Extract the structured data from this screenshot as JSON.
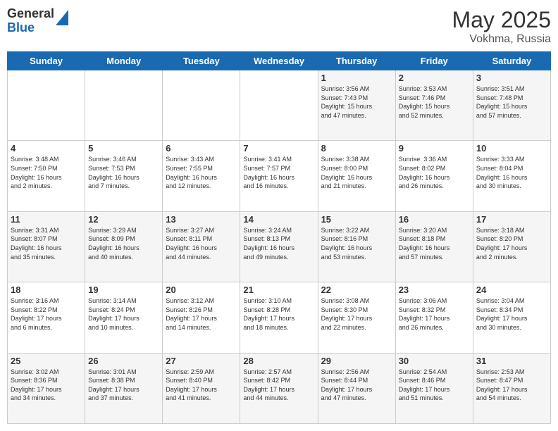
{
  "logo": {
    "general": "General",
    "blue": "Blue"
  },
  "header": {
    "month": "May 2025",
    "location": "Vokhma, Russia"
  },
  "days_of_week": [
    "Sunday",
    "Monday",
    "Tuesday",
    "Wednesday",
    "Thursday",
    "Friday",
    "Saturday"
  ],
  "weeks": [
    [
      {
        "day": "",
        "info": ""
      },
      {
        "day": "",
        "info": ""
      },
      {
        "day": "",
        "info": ""
      },
      {
        "day": "",
        "info": ""
      },
      {
        "day": "1",
        "info": "Sunrise: 3:56 AM\nSunset: 7:43 PM\nDaylight: 15 hours\nand 47 minutes."
      },
      {
        "day": "2",
        "info": "Sunrise: 3:53 AM\nSunset: 7:46 PM\nDaylight: 15 hours\nand 52 minutes."
      },
      {
        "day": "3",
        "info": "Sunrise: 3:51 AM\nSunset: 7:48 PM\nDaylight: 15 hours\nand 57 minutes."
      }
    ],
    [
      {
        "day": "4",
        "info": "Sunrise: 3:48 AM\nSunset: 7:50 PM\nDaylight: 16 hours\nand 2 minutes."
      },
      {
        "day": "5",
        "info": "Sunrise: 3:46 AM\nSunset: 7:53 PM\nDaylight: 16 hours\nand 7 minutes."
      },
      {
        "day": "6",
        "info": "Sunrise: 3:43 AM\nSunset: 7:55 PM\nDaylight: 16 hours\nand 12 minutes."
      },
      {
        "day": "7",
        "info": "Sunrise: 3:41 AM\nSunset: 7:57 PM\nDaylight: 16 hours\nand 16 minutes."
      },
      {
        "day": "8",
        "info": "Sunrise: 3:38 AM\nSunset: 8:00 PM\nDaylight: 16 hours\nand 21 minutes."
      },
      {
        "day": "9",
        "info": "Sunrise: 3:36 AM\nSunset: 8:02 PM\nDaylight: 16 hours\nand 26 minutes."
      },
      {
        "day": "10",
        "info": "Sunrise: 3:33 AM\nSunset: 8:04 PM\nDaylight: 16 hours\nand 30 minutes."
      }
    ],
    [
      {
        "day": "11",
        "info": "Sunrise: 3:31 AM\nSunset: 8:07 PM\nDaylight: 16 hours\nand 35 minutes."
      },
      {
        "day": "12",
        "info": "Sunrise: 3:29 AM\nSunset: 8:09 PM\nDaylight: 16 hours\nand 40 minutes."
      },
      {
        "day": "13",
        "info": "Sunrise: 3:27 AM\nSunset: 8:11 PM\nDaylight: 16 hours\nand 44 minutes."
      },
      {
        "day": "14",
        "info": "Sunrise: 3:24 AM\nSunset: 8:13 PM\nDaylight: 16 hours\nand 49 minutes."
      },
      {
        "day": "15",
        "info": "Sunrise: 3:22 AM\nSunset: 8:16 PM\nDaylight: 16 hours\nand 53 minutes."
      },
      {
        "day": "16",
        "info": "Sunrise: 3:20 AM\nSunset: 8:18 PM\nDaylight: 16 hours\nand 57 minutes."
      },
      {
        "day": "17",
        "info": "Sunrise: 3:18 AM\nSunset: 8:20 PM\nDaylight: 17 hours\nand 2 minutes."
      }
    ],
    [
      {
        "day": "18",
        "info": "Sunrise: 3:16 AM\nSunset: 8:22 PM\nDaylight: 17 hours\nand 6 minutes."
      },
      {
        "day": "19",
        "info": "Sunrise: 3:14 AM\nSunset: 8:24 PM\nDaylight: 17 hours\nand 10 minutes."
      },
      {
        "day": "20",
        "info": "Sunrise: 3:12 AM\nSunset: 8:26 PM\nDaylight: 17 hours\nand 14 minutes."
      },
      {
        "day": "21",
        "info": "Sunrise: 3:10 AM\nSunset: 8:28 PM\nDaylight: 17 hours\nand 18 minutes."
      },
      {
        "day": "22",
        "info": "Sunrise: 3:08 AM\nSunset: 8:30 PM\nDaylight: 17 hours\nand 22 minutes."
      },
      {
        "day": "23",
        "info": "Sunrise: 3:06 AM\nSunset: 8:32 PM\nDaylight: 17 hours\nand 26 minutes."
      },
      {
        "day": "24",
        "info": "Sunrise: 3:04 AM\nSunset: 8:34 PM\nDaylight: 17 hours\nand 30 minutes."
      }
    ],
    [
      {
        "day": "25",
        "info": "Sunrise: 3:02 AM\nSunset: 8:36 PM\nDaylight: 17 hours\nand 34 minutes."
      },
      {
        "day": "26",
        "info": "Sunrise: 3:01 AM\nSunset: 8:38 PM\nDaylight: 17 hours\nand 37 minutes."
      },
      {
        "day": "27",
        "info": "Sunrise: 2:59 AM\nSunset: 8:40 PM\nDaylight: 17 hours\nand 41 minutes."
      },
      {
        "day": "28",
        "info": "Sunrise: 2:57 AM\nSunset: 8:42 PM\nDaylight: 17 hours\nand 44 minutes."
      },
      {
        "day": "29",
        "info": "Sunrise: 2:56 AM\nSunset: 8:44 PM\nDaylight: 17 hours\nand 47 minutes."
      },
      {
        "day": "30",
        "info": "Sunrise: 2:54 AM\nSunset: 8:46 PM\nDaylight: 17 hours\nand 51 minutes."
      },
      {
        "day": "31",
        "info": "Sunrise: 2:53 AM\nSunset: 8:47 PM\nDaylight: 17 hours\nand 54 minutes."
      }
    ]
  ]
}
